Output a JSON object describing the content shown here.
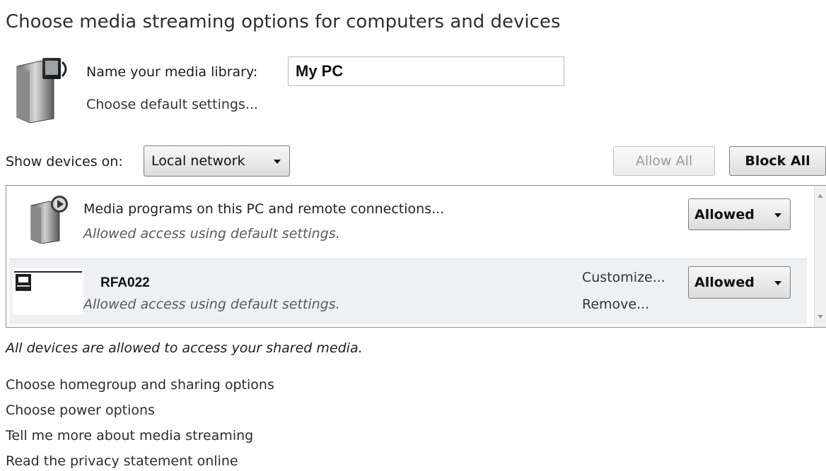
{
  "page": {
    "title": "Choose media streaming options for computers and devices"
  },
  "library": {
    "name_label": "Name your media library:",
    "name_value": "My PC",
    "default_settings_link": "Choose default settings..."
  },
  "device_filter": {
    "label": "Show devices on:",
    "selected": "Local network"
  },
  "toolbar": {
    "allow_all_label": "Allow All",
    "block_all_label": "Block All"
  },
  "devices": [
    {
      "name": "Media programs on this PC and remote connections...",
      "status_text": "Allowed access using default settings.",
      "access": "Allowed",
      "icon": "media-player-icon"
    },
    {
      "name": "RFA022",
      "status_text": "Allowed access using default settings.",
      "access": "Allowed",
      "customize_label": "Customize...",
      "remove_label": "Remove...",
      "icon": "device-thumbnail"
    }
  ],
  "status_message": "All devices are allowed to access your shared media.",
  "links": [
    "Choose homegroup and sharing options",
    "Choose power options",
    "Tell me more about media streaming",
    "Read the privacy statement online"
  ]
}
